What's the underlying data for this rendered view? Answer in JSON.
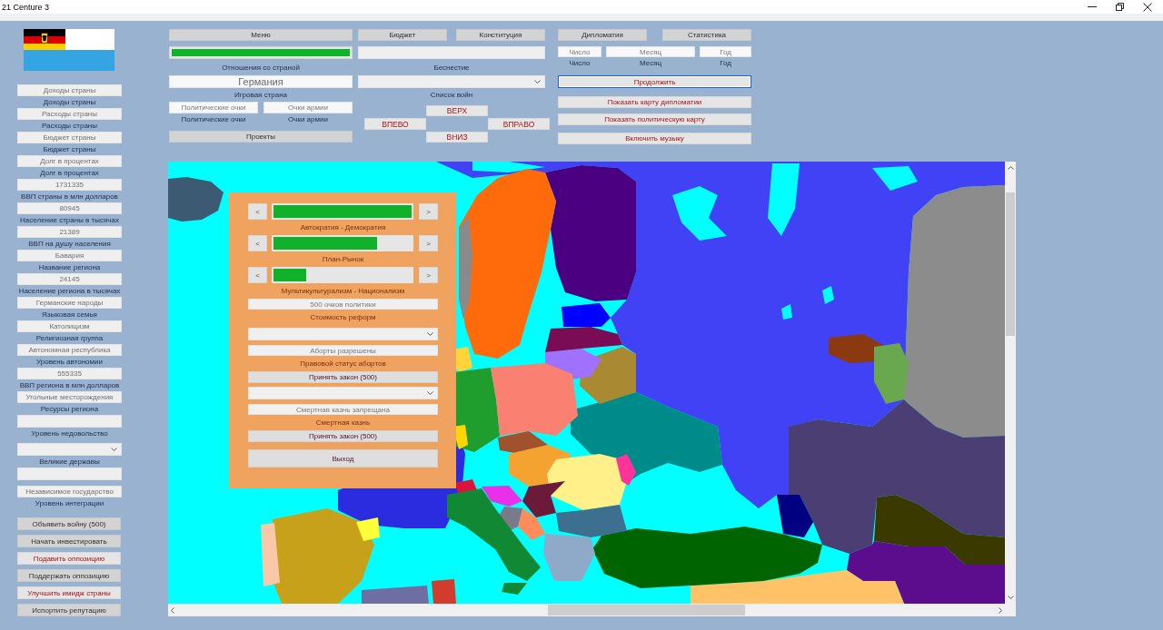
{
  "window": {
    "title": "21 Centure 3"
  },
  "sidebar": {
    "items": [
      {
        "kind": "field",
        "value": "Доходы страны"
      },
      {
        "kind": "label",
        "text": "Доходы страны"
      },
      {
        "kind": "field",
        "value": "Расходы страны"
      },
      {
        "kind": "label",
        "text": "Расходы страны"
      },
      {
        "kind": "field",
        "value": "Бюджет страны"
      },
      {
        "kind": "label",
        "text": "Бюджет страны"
      },
      {
        "kind": "field",
        "value": "Долг в процентах"
      },
      {
        "kind": "label",
        "text": "Долг в процентах"
      },
      {
        "kind": "field",
        "value": "1731335"
      },
      {
        "kind": "label",
        "text": "ВВП страны в млн долларов"
      },
      {
        "kind": "field",
        "value": "80945"
      },
      {
        "kind": "label",
        "text": "Население страны в тысячах"
      },
      {
        "kind": "field",
        "value": "21389"
      },
      {
        "kind": "label",
        "text": "ВВП на душу населения"
      },
      {
        "kind": "field",
        "value": "Бавария"
      },
      {
        "kind": "label",
        "text": "Название региона"
      },
      {
        "kind": "field",
        "value": "24145"
      },
      {
        "kind": "label",
        "text": "Население региона в тысячах"
      },
      {
        "kind": "field",
        "value": "Германские народы"
      },
      {
        "kind": "label",
        "text": "Языковая семья"
      },
      {
        "kind": "field",
        "value": "Католицизм"
      },
      {
        "kind": "label",
        "text": "Религиозная группа"
      },
      {
        "kind": "field",
        "value": "Автономная республика"
      },
      {
        "kind": "label",
        "text": "Уровень автономии"
      },
      {
        "kind": "field",
        "value": "555335"
      },
      {
        "kind": "label",
        "text": "ВВП региона в млн долларов"
      },
      {
        "kind": "field",
        "value": "Угольные месторождения"
      },
      {
        "kind": "label",
        "text": "Ресурсы региона"
      },
      {
        "kind": "field"
      },
      {
        "kind": "label",
        "text": "Уровень недовольство"
      },
      {
        "kind": "dropdown"
      },
      {
        "kind": "label",
        "text": "Великие державы"
      },
      {
        "kind": "field"
      },
      {
        "kind": "field",
        "value": "Независимое государство"
      },
      {
        "kind": "label",
        "text": "Уровень интеграции"
      }
    ],
    "buttons": [
      {
        "label": "Объявить войну (500)",
        "kind": "standard"
      },
      {
        "label": "Начать инвестировать",
        "kind": "standard"
      },
      {
        "label": "Подавить оппозицию",
        "kind": "accent"
      },
      {
        "label": "Поддержать оппозицию",
        "kind": "standard"
      },
      {
        "label": "Улучшить имидж страны",
        "kind": "accent"
      },
      {
        "label": "Испортить репутацию",
        "kind": "standard"
      }
    ]
  },
  "top_panel": {
    "country": {
      "menu_button": "Меню",
      "relations": {
        "level": 1
      },
      "relations_label": "Отношения со страной",
      "country_field": "Германия",
      "country_label": "Игровая страна",
      "points": [
        {
          "value": "Политические очки",
          "label": "Политические очки"
        },
        {
          "value": "Очки армии",
          "label": "Очки армии"
        }
      ],
      "projects_button": "Проекты"
    },
    "wars": {
      "buttons": [
        "Бюджет",
        "Конституция"
      ],
      "status_label": "Беснестие",
      "wars_label": "Список войн",
      "arrows": [
        {
          "label": "ВЕРХ",
          "kind": "up"
        },
        {
          "label": "ВПЕВО",
          "kind": "left"
        },
        {
          "label": "ВПРАВО",
          "kind": "right"
        },
        {
          "label": "ВНИЗ",
          "kind": "down"
        }
      ]
    },
    "date": {
      "buttons": [
        "Дипломатия",
        "Статистика"
      ],
      "fields": [
        {
          "value": "Число",
          "label": "Число"
        },
        {
          "value": "Месяц",
          "label": "Месяц"
        },
        {
          "value": "Год",
          "label": "Год"
        }
      ],
      "actions": [
        {
          "label": "Продолжить",
          "focused": true
        },
        {
          "label": "Показать карту дипломатии",
          "focused": false
        },
        {
          "label": "Показать политическую карту",
          "focused": false
        },
        {
          "label": "Включить музыку",
          "focused": false
        }
      ]
    }
  },
  "reform_dialog": {
    "sliders": [
      {
        "decrease": "<",
        "increase": ">",
        "level": 1,
        "label": "Автократия - Демократия"
      },
      {
        "decrease": "<",
        "increase": ">",
        "level": 0.75,
        "label": "План-Рынок"
      },
      {
        "decrease": "<",
        "increase": ">",
        "level": 0.24,
        "label": "Мультикультурализм - Национализм"
      }
    ],
    "cost_field": "500 очков политики",
    "cost_label": "Стоимость реформ",
    "laws": [
      {
        "value": "Аборты разрешены",
        "label": "Правовой статус абортов",
        "button": "Принять закон (500)"
      },
      {
        "value": "Смертная казнь запрещана",
        "label": "Смертная казнь",
        "button": "Принять закон (500)"
      }
    ],
    "exit_button": "Выход"
  }
}
